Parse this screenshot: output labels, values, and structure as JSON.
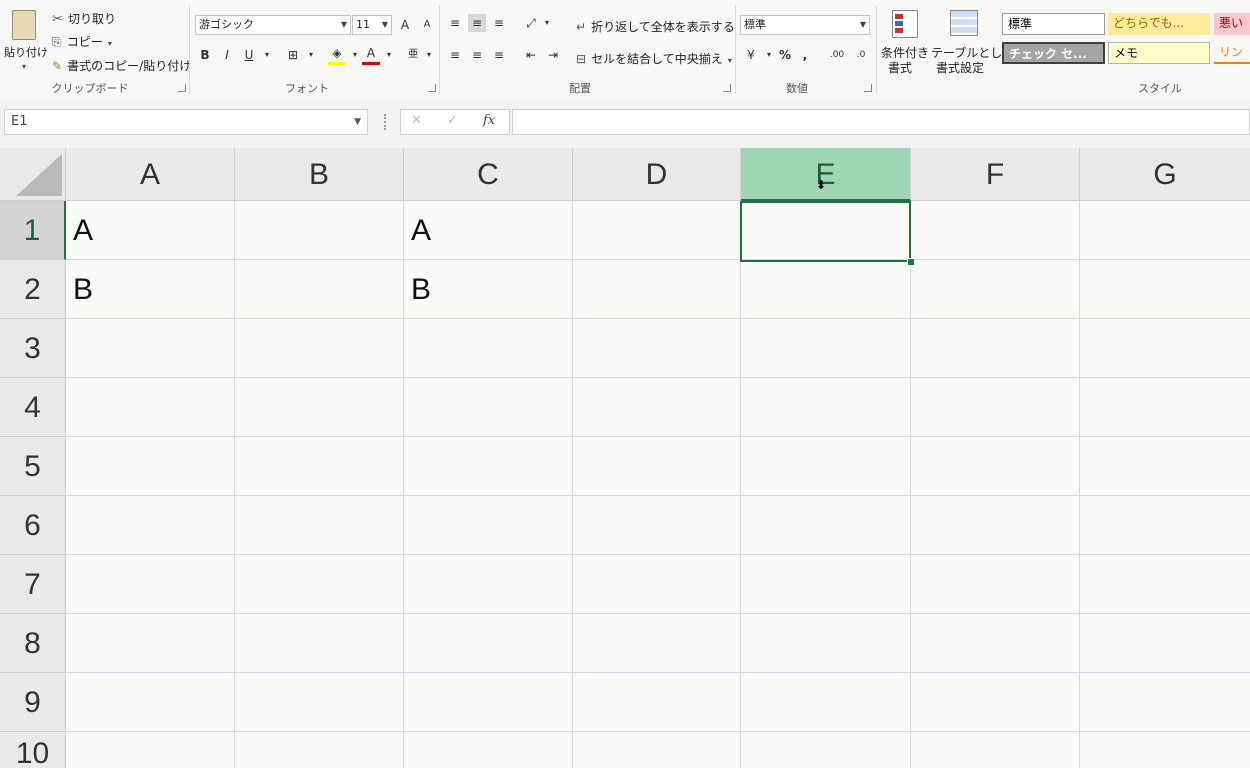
{
  "ribbon": {
    "clipboard": {
      "paste": "貼り付け",
      "cut": "切り取り",
      "copy": "コピー",
      "format_painter": "書式のコピー/貼り付け",
      "group": "クリップボード"
    },
    "font": {
      "font_name": "游ゴシック",
      "font_size": "11",
      "grow": "A",
      "shrink": "A",
      "bold": "B",
      "italic": "I",
      "underline": "U",
      "font_color": "A",
      "phonetic": "亜",
      "group": "フォント"
    },
    "alignment": {
      "wrap_text": "折り返して全体を表示する",
      "merge_center": "セルを結合して中央揃え",
      "group": "配置"
    },
    "number": {
      "format": "標準",
      "percent": "%",
      "comma": ",",
      "inc_decimal": ".00",
      "dec_decimal": ".0",
      "group": "数値"
    },
    "styles": {
      "conditional_1": "条件付き",
      "conditional_2": "書式",
      "table_1": "テーブルとして",
      "table_2": "書式設定",
      "cells": [
        "標準",
        "どちらでも...",
        "悪い",
        "チェック セ...",
        "メモ",
        "リン"
      ],
      "group": "スタイル"
    }
  },
  "formula_bar": {
    "name_box": "E1",
    "cancel": "✕",
    "enter": "✓",
    "fx": "fx",
    "formula": ""
  },
  "sheet": {
    "columns": [
      "A",
      "B",
      "C",
      "D",
      "E",
      "F",
      "G"
    ],
    "rows": [
      "1",
      "2",
      "3",
      "4",
      "5",
      "6",
      "7",
      "8",
      "9",
      "10"
    ],
    "cells": {
      "A1": "A",
      "A2": "B",
      "C1": "A",
      "C2": "B"
    },
    "selected": "E1"
  },
  "colors": {
    "accent": "#217346",
    "selected_header": "#9fd5b4"
  }
}
